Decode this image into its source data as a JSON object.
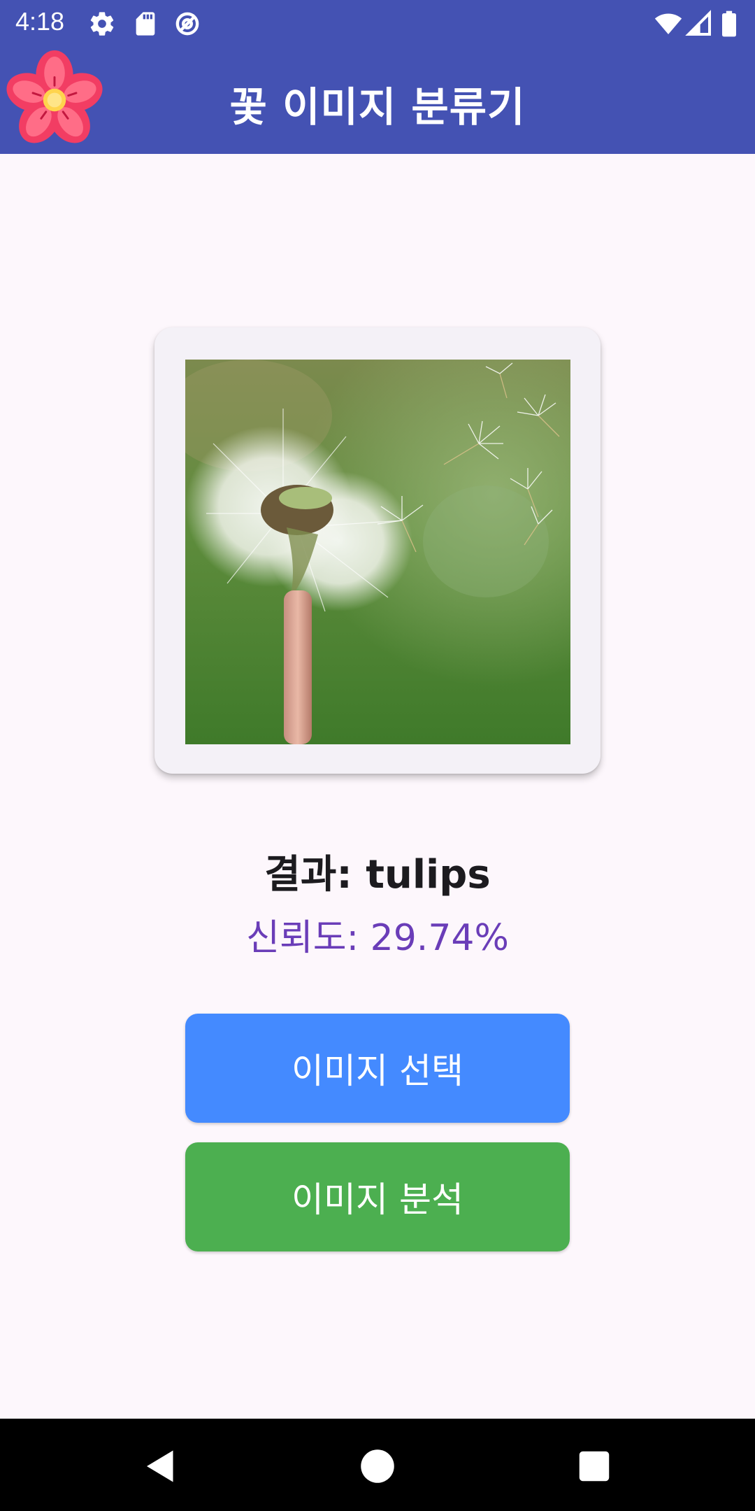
{
  "status_bar": {
    "time": "4:18",
    "left_icons": [
      "gear-icon",
      "sd-card-icon",
      "data-saver-icon"
    ],
    "right_icons": [
      "wifi-icon",
      "cell-signal-icon",
      "battery-icon"
    ]
  },
  "app_bar": {
    "title": "꽃 이미지 분류기",
    "logo_icon": "flower-icon",
    "color": "#4452B3"
  },
  "image_card": {
    "image_description_icon": "dandelion-photo"
  },
  "result": {
    "label": "결과: tulips",
    "confidence": "신뢰도: 29.74%"
  },
  "buttons": {
    "select_image": "이미지 선택",
    "analyze_image": "이미지 분석",
    "select_color": "#448AFF",
    "analyze_color": "#4CAF50"
  },
  "nav_bar": {
    "icons": [
      "back-icon",
      "home-icon",
      "recents-icon"
    ]
  }
}
